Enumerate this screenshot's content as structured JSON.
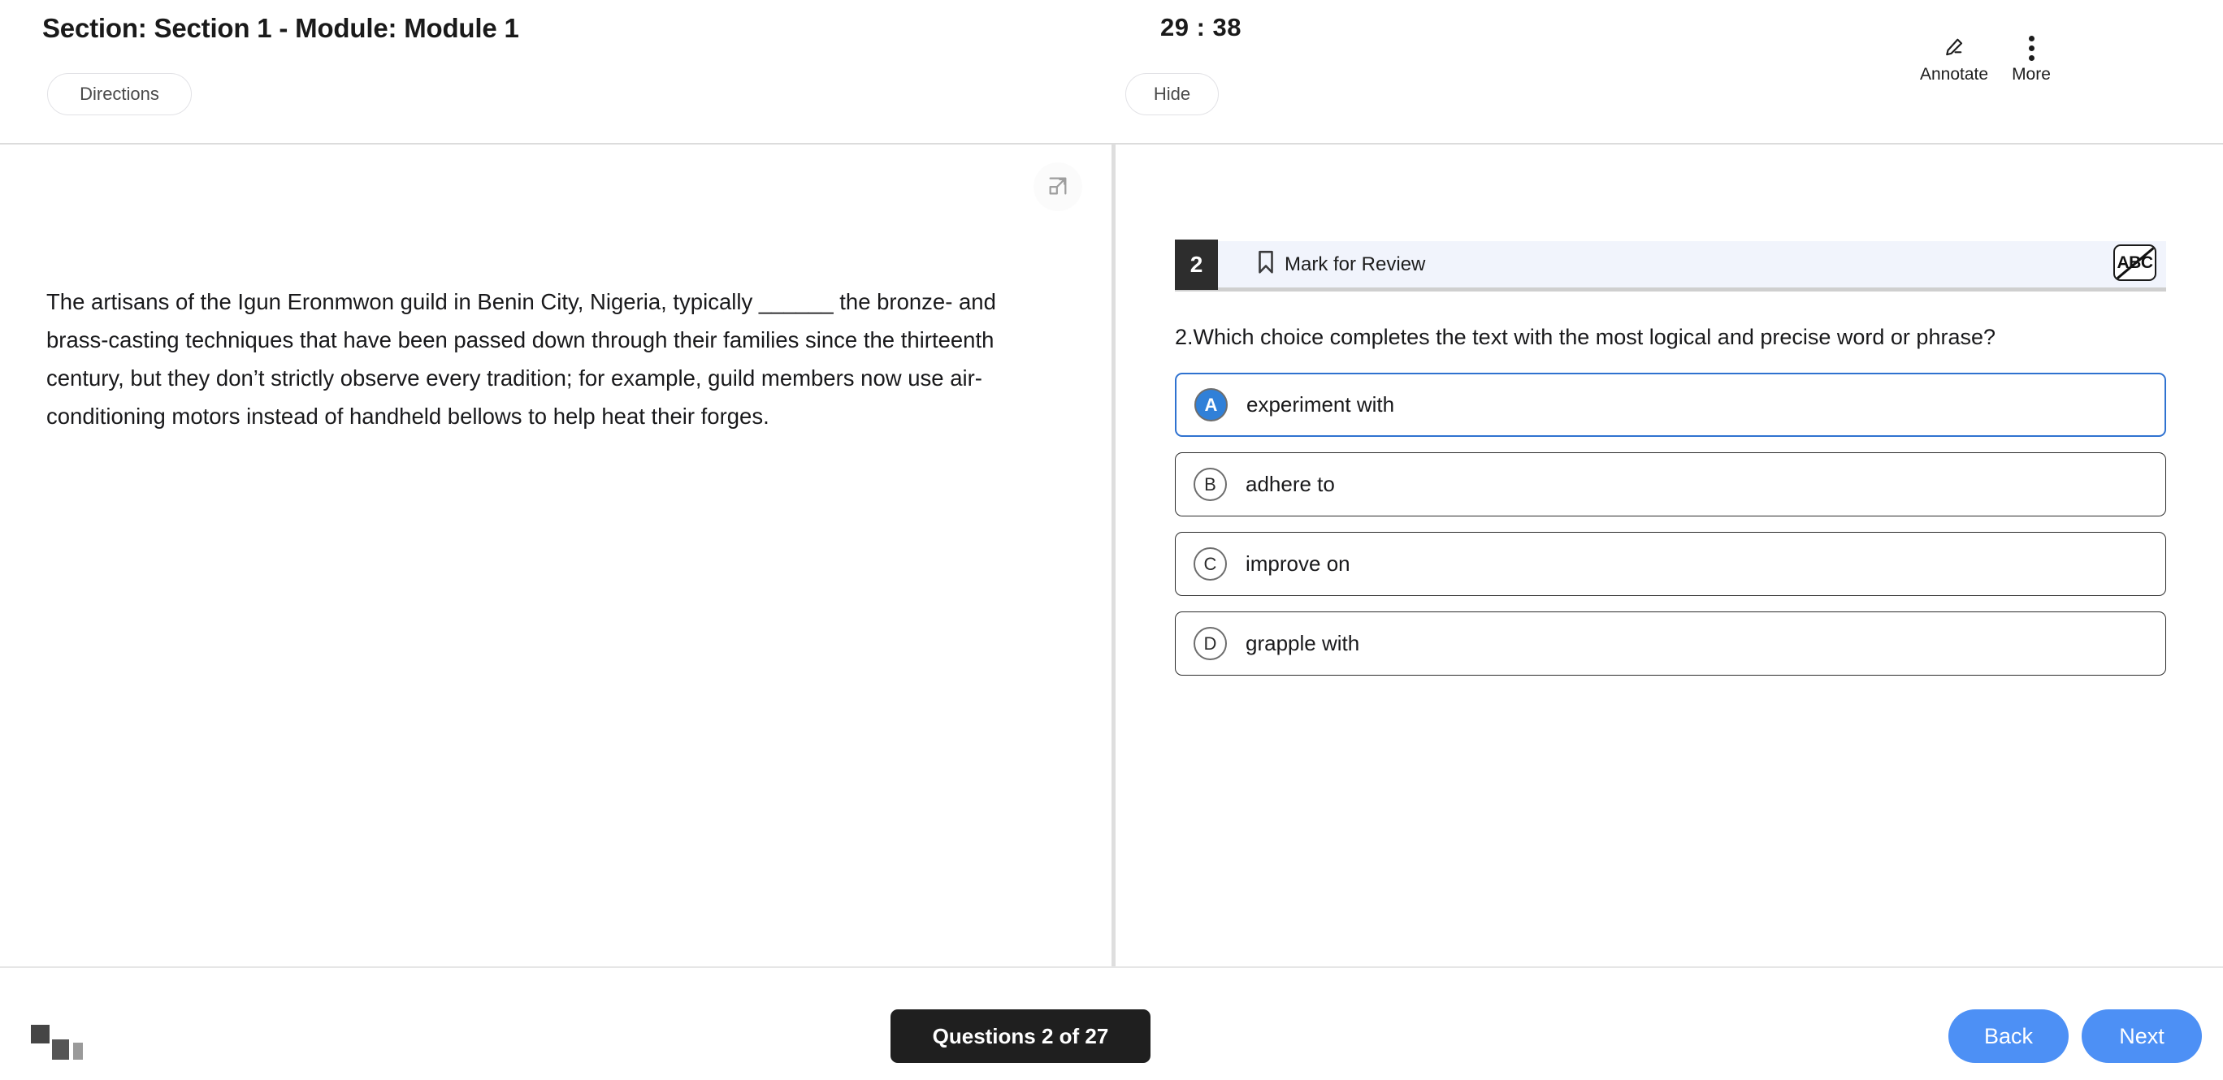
{
  "header": {
    "title": "Section: Section 1 - Module: Module 1",
    "directions_label": "Directions",
    "timer": "29 : 38",
    "hide_label": "Hide",
    "annotate_label": "Annotate",
    "annotate_icon": "pencil-icon",
    "more_label": "More",
    "more_icon": "more-vertical-icon"
  },
  "panels": {
    "expand_left_icon": "expand-panel-right-icon",
    "expand_right_icon": "expand-panel-left-icon",
    "passage": "The artisans of the Igun Eronmwon guild in Benin City, Nigeria, typically ______ the bronze- and brass-casting techniques that have been passed down through their families since the thirteenth century, but they don’t strictly observe every tradition; for example, guild members now use air-conditioning motors instead of handheld bellows to help heat their forges."
  },
  "question": {
    "number": "2",
    "mark_for_review_label": "Mark for Review",
    "mark_icon": "bookmark-icon",
    "crossout_label": "ABC",
    "crossout_icon": "abc-crossout-icon",
    "stem": "2.Which choice completes the text with the most logical and precise word or phrase?",
    "choices": [
      {
        "letter": "A",
        "text": "experiment with",
        "selected": true
      },
      {
        "letter": "B",
        "text": "adhere to",
        "selected": false
      },
      {
        "letter": "C",
        "text": "improve on",
        "selected": false
      },
      {
        "letter": "D",
        "text": "grapple with",
        "selected": false
      }
    ]
  },
  "footer": {
    "logo_icon": "stair-blocks-logo",
    "question_counter": "Questions 2 of 27",
    "back_label": "Back",
    "next_label": "Next"
  },
  "colors": {
    "accent_blue": "#4d90f5",
    "selected_blue": "#3080d8",
    "qbar_bg": "#f1f4fc",
    "qnum_bg": "#2d2d2d",
    "counter_bg": "#1f1f1f"
  }
}
